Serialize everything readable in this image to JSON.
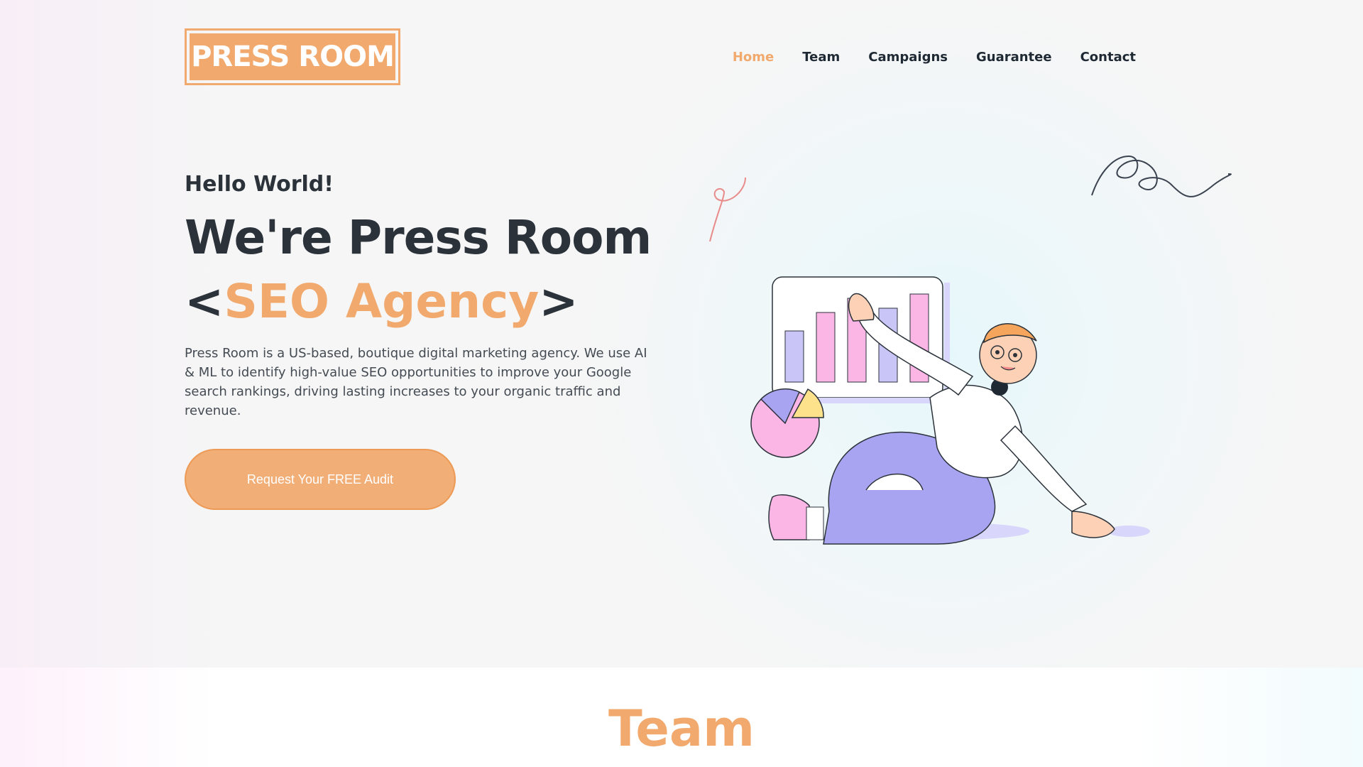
{
  "logo": {
    "text": "PRESS ROOM"
  },
  "nav": {
    "items": [
      {
        "label": "Home",
        "active": true
      },
      {
        "label": "Team",
        "active": false
      },
      {
        "label": "Campaigns",
        "active": false
      },
      {
        "label": "Guarantee",
        "active": false
      },
      {
        "label": "Contact",
        "active": false
      }
    ]
  },
  "hero": {
    "greeting": "Hello World!",
    "headline": "We're Press Room",
    "sub_prefix": "<",
    "sub_accent": "SEO Agency",
    "sub_suffix": ">",
    "description": "Press Room is a US-based, boutique digital marketing agency. We use AI & ML to identify high-value SEO opportunities to improve your Google search rankings, driving lasting increases to your organic traffic and revenue.",
    "cta_label": "Request Your FREE Audit"
  },
  "team": {
    "heading": "Team"
  },
  "colors": {
    "accent": "#f1a96d",
    "text_dark": "#2b323a",
    "bar_pink": "#fbb6e6",
    "bar_purple": "#c9c5f7",
    "pants": "#a9a4f1"
  },
  "illustration": {
    "icon": "person-presenting-chart-illustration"
  }
}
